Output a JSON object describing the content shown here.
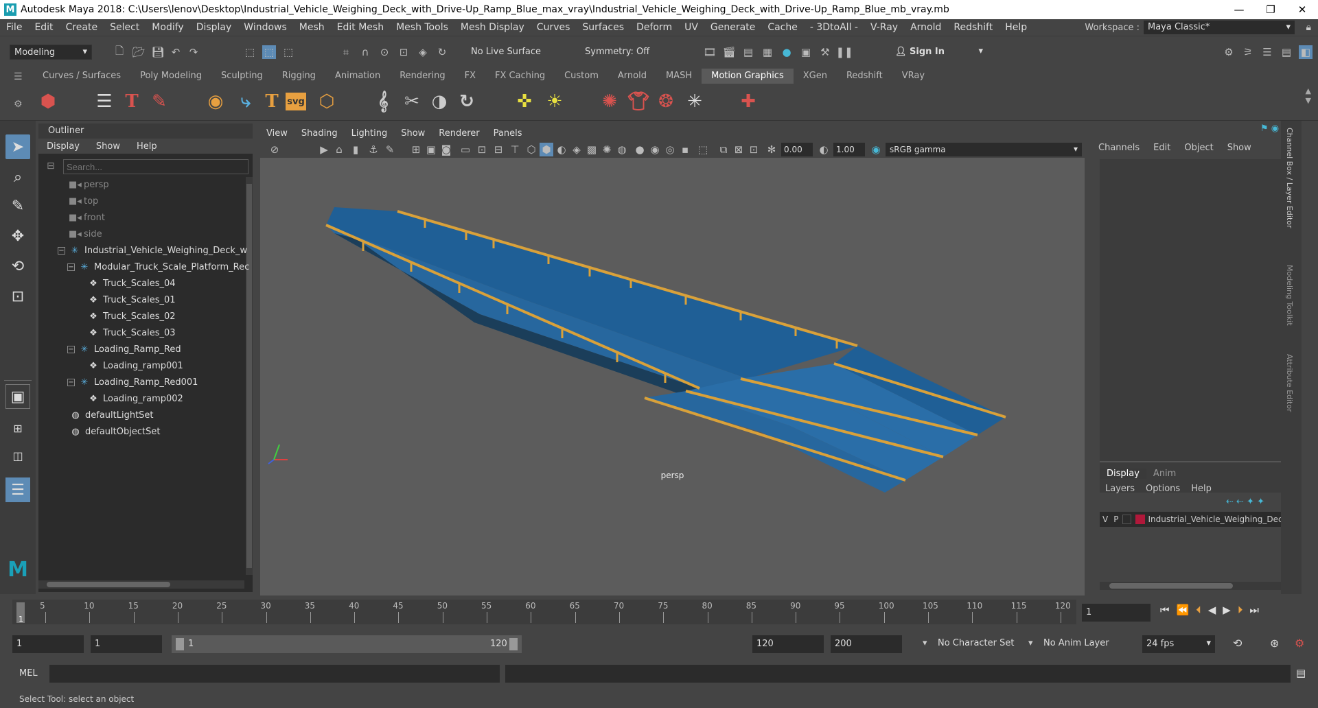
{
  "window": {
    "title": "Autodesk Maya 2018: C:\\Users\\lenov\\Desktop\\Industrial_Vehicle_Weighing_Deck_with_Drive-Up_Ramp_Blue_max_vray\\Industrial_Vehicle_Weighing_Deck_with_Drive-Up_Ramp_Blue_mb_vray.mb",
    "logo": "M",
    "minimize": "—",
    "restore": "❐",
    "close": "✕"
  },
  "menubar": {
    "items": [
      "File",
      "Edit",
      "Create",
      "Select",
      "Modify",
      "Display",
      "Windows",
      "Mesh",
      "Edit Mesh",
      "Mesh Tools",
      "Mesh Display",
      "Curves",
      "Surfaces",
      "Deform",
      "UV",
      "Generate",
      "Cache",
      "- 3DtoAll -",
      "V-Ray",
      "Arnold",
      "Redshift",
      "Help"
    ],
    "workspace_label": "Workspace :",
    "workspace_value": "Maya Classic*"
  },
  "statusline": {
    "mode": "Modeling",
    "live_surface": "No Live Surface",
    "symmetry": "Symmetry: Off",
    "sign_in": "Sign In"
  },
  "shelf": {
    "tabs": [
      "Curves / Surfaces",
      "Poly Modeling",
      "Sculpting",
      "Rigging",
      "Animation",
      "Rendering",
      "FX",
      "FX Caching",
      "Custom",
      "Arnold",
      "MASH",
      "Motion Graphics",
      "XGen",
      "Redshift",
      "VRay"
    ],
    "active_tab": "Motion Graphics",
    "svg_label": "svg",
    "text_label": "T"
  },
  "outliner": {
    "title": "Outliner",
    "menu": [
      "Display",
      "Show",
      "Help"
    ],
    "search_placeholder": "Search...",
    "items": [
      {
        "label": "persp",
        "dim": true
      },
      {
        "label": "top",
        "dim": true
      },
      {
        "label": "front",
        "dim": true
      },
      {
        "label": "side",
        "dim": true
      },
      {
        "label": "Industrial_Vehicle_Weighing_Deck_w"
      },
      {
        "label": "Modular_Truck_Scale_Platform_Rec"
      },
      {
        "label": "Truck_Scales_04"
      },
      {
        "label": "Truck_Scales_01"
      },
      {
        "label": "Truck_Scales_02"
      },
      {
        "label": "Truck_Scales_03"
      },
      {
        "label": "Loading_Ramp_Red"
      },
      {
        "label": "Loading_ramp001"
      },
      {
        "label": "Loading_Ramp_Red001"
      },
      {
        "label": "Loading_ramp002"
      },
      {
        "label": "defaultLightSet"
      },
      {
        "label": "defaultObjectSet"
      }
    ]
  },
  "viewport": {
    "menu": [
      "View",
      "Shading",
      "Lighting",
      "Show",
      "Renderer",
      "Panels"
    ],
    "exposure": "0.00",
    "gamma": "1.00",
    "colorspace": "sRGB gamma",
    "camera_label": "persp"
  },
  "channelbox": {
    "menu": [
      "Channels",
      "Edit",
      "Object",
      "Show"
    ],
    "side_tabs": [
      "Channel Box / Layer Editor",
      "Modeling Toolkit",
      "Attribute Editor"
    ],
    "layer_tabs": [
      "Display",
      "Anim"
    ],
    "layer_menu": [
      "Layers",
      "Options",
      "Help"
    ],
    "layer": {
      "v": "V",
      "p": "P",
      "name": "Industrial_Vehicle_Weighing_Deck_w",
      "color": "#b0183a"
    }
  },
  "timeline": {
    "ticks": [
      "5",
      "10",
      "15",
      "20",
      "25",
      "30",
      "35",
      "40",
      "45",
      "50",
      "55",
      "60",
      "65",
      "70",
      "75",
      "80",
      "85",
      "90",
      "95",
      "100",
      "105",
      "110",
      "115",
      "120"
    ],
    "current_marker": "1",
    "current_frame": "1"
  },
  "range": {
    "start": "1",
    "playback_start": "1",
    "slider_start": "1",
    "slider_end": "120",
    "playback_end": "120",
    "end": "200",
    "character_set": "No Character Set",
    "anim_layer": "No Anim Layer",
    "fps": "24 fps"
  },
  "cmdline": {
    "label": "MEL"
  },
  "helpline": {
    "text": "Select Tool: select an object"
  },
  "colors": {
    "deck": "#2a6ea8",
    "rail": "#d9a13a",
    "background": "#5c5c5c"
  }
}
